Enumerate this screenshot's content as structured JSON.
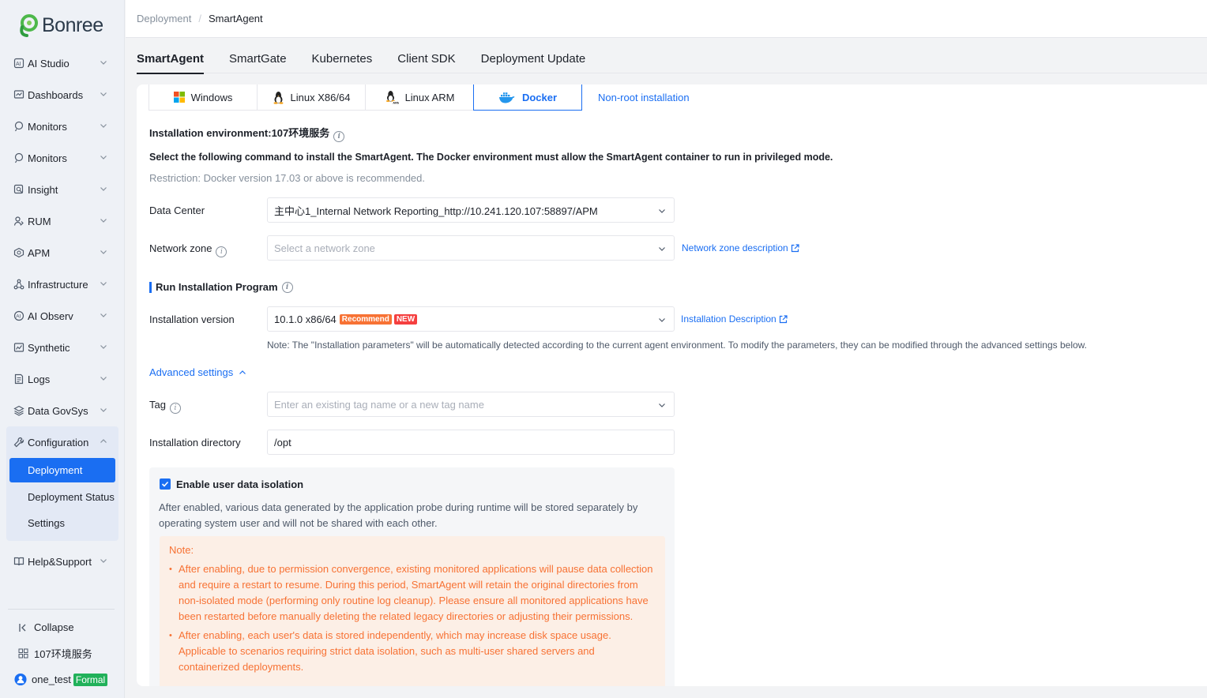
{
  "brand": {
    "name": "Bonree"
  },
  "sidebar": {
    "items": [
      {
        "label": "AI Studio",
        "icon": "ai-studio-icon"
      },
      {
        "label": "Dashboards",
        "icon": "dashboard-icon"
      },
      {
        "label": "Monitors",
        "icon": "monitor-icon"
      },
      {
        "label": "Monitors",
        "icon": "monitor-icon"
      },
      {
        "label": "Insight",
        "icon": "insight-icon"
      },
      {
        "label": "RUM",
        "icon": "rum-icon"
      },
      {
        "label": "APM",
        "icon": "apm-icon"
      },
      {
        "label": "Infrastructure",
        "icon": "infrastructure-icon"
      },
      {
        "label": "AI Observ",
        "icon": "ai-observ-icon"
      },
      {
        "label": "Synthetic",
        "icon": "synthetic-icon"
      },
      {
        "label": "Logs",
        "icon": "logs-icon"
      },
      {
        "label": "Data GovSys",
        "icon": "data-gov-icon"
      }
    ],
    "configuration": {
      "label": "Configuration",
      "children": [
        "Deployment",
        "Deployment Status",
        "Settings"
      ]
    },
    "help": "Help&Support",
    "collapse": "Collapse",
    "environment": "107环境服务",
    "user": "one_test",
    "user_badge": "Formal"
  },
  "breadcrumb": [
    "Deployment",
    "SmartAgent"
  ],
  "tabs": [
    "SmartAgent",
    "SmartGate",
    "Kubernetes",
    "Client SDK",
    "Deployment Update"
  ],
  "os_tabs": [
    "Windows",
    "Linux X86/64",
    "Linux ARM",
    "Docker"
  ],
  "non_root_link": "Non-root installation",
  "install_env": "Installation environment:107环境服务",
  "command_intro": "Select the following command to install the SmartAgent. The Docker environment must allow the SmartAgent container to run in privileged mode.",
  "restriction": "Restriction: Docker version 17.03 or above is recommended.",
  "data_center": {
    "label": "Data Center",
    "value": "主中心1_Internal Network Reporting_http://10.241.120.107:58897/APM"
  },
  "network_zone": {
    "label": "Network zone",
    "placeholder": "Select a network zone",
    "link": "Network zone description"
  },
  "run_section": "Run Installation Program",
  "install_version": {
    "label": "Installation version",
    "value": "10.1.0 x86/64",
    "tag_recommend": "Recommend",
    "tag_new": "NEW",
    "link": "Installation Description",
    "note": "Note: The \"Installation parameters\" will be automatically detected according to the current agent environment. To modify the parameters, they can be modified through the advanced settings below."
  },
  "advanced_settings": "Advanced settings",
  "tag_field": {
    "label": "Tag",
    "placeholder": "Enter an existing tag name or a new tag name"
  },
  "install_dir": {
    "label": "Installation directory",
    "value": "/opt"
  },
  "isolation": {
    "label": "Enable user data isolation",
    "checked": true,
    "desc_line1": "After enabled, various data generated by the application probe during runtime will be stored separately by",
    "desc_line2": "operating system user and will not be shared with each other.",
    "note_title": "Note:",
    "note1": "After enabling, due to permission convergence, existing monitored applications will pause data collection and require a restart to resume. During this period, SmartAgent will retain the original directories from non-isolated mode (performing only routine log cleanup). Please ensure all monitored applications have been restarted before manually deleting the related legacy directories or adjusting their permissions.",
    "note2": "After enabling, each user's data is stored independently, which may increase disk space usage. Applicable to scenarios requiring strict data isolation, such as multi-user shared servers and containerized deployments."
  },
  "colors": {
    "accent": "#1a6ef2",
    "warning": "#f77234",
    "success": "#21b15a"
  }
}
